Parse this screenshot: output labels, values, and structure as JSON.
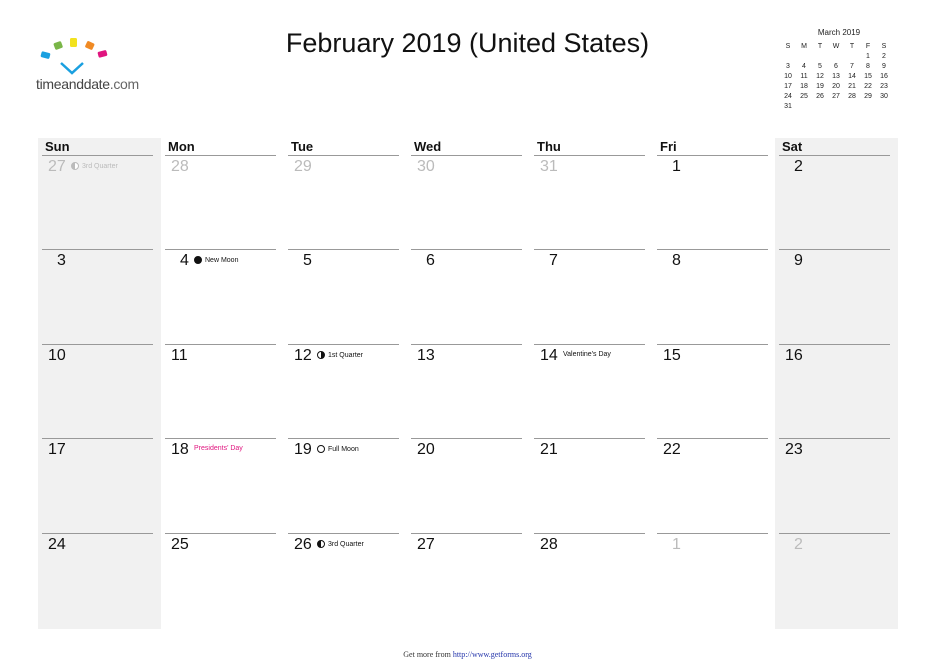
{
  "logo": {
    "text_a": "timeanddate",
    "text_b": ".com"
  },
  "title": "February 2019 (United States)",
  "mini_calendar": {
    "title": "March 2019",
    "weekdays": [
      "S",
      "M",
      "T",
      "W",
      "T",
      "F",
      "S"
    ],
    "cells": [
      "",
      "",
      "",
      "",
      "",
      "1",
      "2",
      "3",
      "4",
      "5",
      "6",
      "7",
      "8",
      "9",
      "10",
      "11",
      "12",
      "13",
      "14",
      "15",
      "16",
      "17",
      "18",
      "19",
      "20",
      "21",
      "22",
      "23",
      "24",
      "25",
      "26",
      "27",
      "28",
      "29",
      "30",
      "31",
      "",
      "",
      "",
      "",
      "",
      ""
    ]
  },
  "calendar": {
    "weekdays": [
      "Sun",
      "Mon",
      "Tue",
      "Wed",
      "Thu",
      "Fri",
      "Sat"
    ],
    "weeks": [
      [
        {
          "day": "27",
          "other": true,
          "event": "3rd Quarter",
          "moon": "dim"
        },
        {
          "day": "28",
          "other": true
        },
        {
          "day": "29",
          "other": true
        },
        {
          "day": "30",
          "other": true
        },
        {
          "day": "31",
          "other": true
        },
        {
          "day": "1"
        },
        {
          "day": "2"
        }
      ],
      [
        {
          "day": "3"
        },
        {
          "day": "4",
          "event": "New Moon",
          "moon": "new"
        },
        {
          "day": "5"
        },
        {
          "day": "6"
        },
        {
          "day": "7"
        },
        {
          "day": "8"
        },
        {
          "day": "9"
        }
      ],
      [
        {
          "day": "10"
        },
        {
          "day": "11"
        },
        {
          "day": "12",
          "event": "1st Quarter",
          "moon": "first"
        },
        {
          "day": "13"
        },
        {
          "day": "14",
          "event": "Valentine's Day"
        },
        {
          "day": "15"
        },
        {
          "day": "16"
        }
      ],
      [
        {
          "day": "17"
        },
        {
          "day": "18",
          "event": "Presidents' Day",
          "holiday": true
        },
        {
          "day": "19",
          "event": "Full Moon",
          "moon": "full"
        },
        {
          "day": "20"
        },
        {
          "day": "21"
        },
        {
          "day": "22"
        },
        {
          "day": "23"
        }
      ],
      [
        {
          "day": "24"
        },
        {
          "day": "25"
        },
        {
          "day": "26",
          "event": "3rd Quarter",
          "moon": "third"
        },
        {
          "day": "27"
        },
        {
          "day": "28"
        },
        {
          "day": "1",
          "other": true
        },
        {
          "day": "2",
          "other": true
        }
      ]
    ]
  },
  "colors": {
    "holiday": "#e0157f",
    "weekend_bg": "#f1f1f1",
    "other_month": "#bbbbbb"
  },
  "footer": {
    "prefix": "Get more from ",
    "link": "http://www.getforms.org"
  }
}
